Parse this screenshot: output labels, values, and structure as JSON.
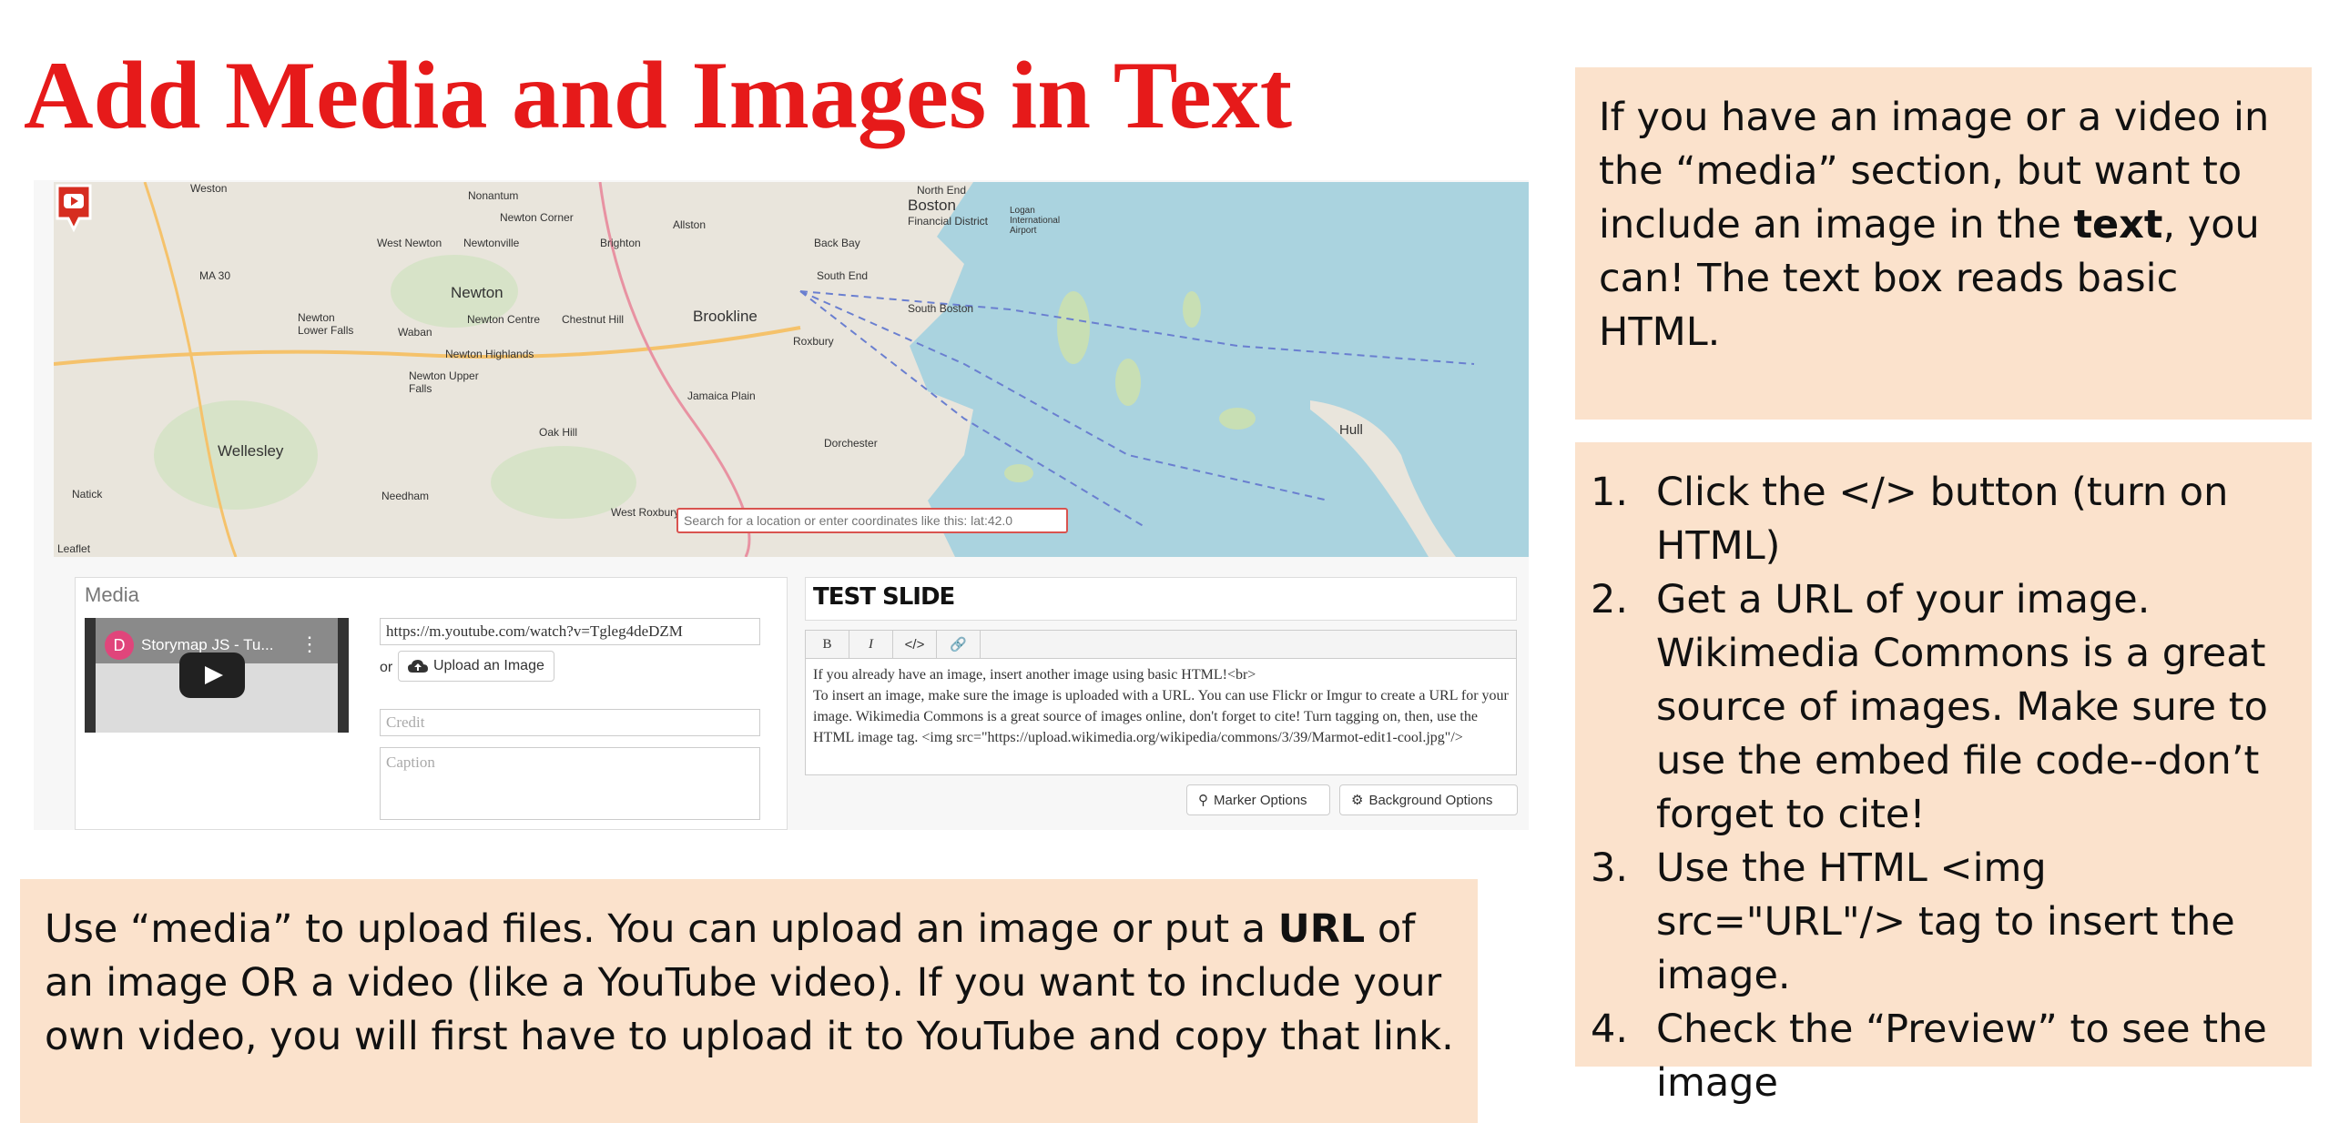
{
  "slide": {
    "title": "Add Media and Images in Text"
  },
  "callout_top": {
    "pre": "If you have an image or a video in the “media” section, but want to include an image in the ",
    "bold": "text",
    "post": ", you can! The text box reads basic HTML."
  },
  "callout_steps": [
    {
      "num": "1.",
      "text": "Click the </> button (turn on HTML)"
    },
    {
      "num": "2.",
      "text": "Get a URL of your image. Wikimedia Commons is a great source of images. Make sure to use the embed file code--don’t forget to cite!"
    },
    {
      "num": "3.",
      "text": "Use the HTML <img src=\"URL\"/> tag to insert the image."
    },
    {
      "num": "4.",
      "text": "Check the “Preview” to see the image"
    }
  ],
  "callout_bottom": {
    "pre": "Use “media” to upload files. You can upload an image or put a ",
    "bold": "URL",
    "post": " of an image OR a video (like a YouTube video). If you want to include your own video, you will first have to upload it to YouTube and copy that link."
  },
  "map": {
    "labels": [
      "Weston",
      "Nonantum",
      "Newton Corner",
      "Allston",
      "North End",
      "Boston",
      "Financial District",
      "Logan International Airport",
      "West Newton",
      "Newtonville",
      "Brighton",
      "Back Bay",
      "MA 30",
      "Newton",
      "South End",
      "Newton Lower Falls",
      "Waban",
      "Newton Centre",
      "Chestnut Hill",
      "Brookline",
      "South Boston",
      "Newton Highlands",
      "Roxbury",
      "Newton Upper Falls",
      "Jamaica Plain",
      "Oak Hill",
      "Hull",
      "Wellesley",
      "Dorchester",
      "Natick",
      "Needham",
      "West Roxbury"
    ],
    "search_placeholder": "Search for a location or enter coordinates like this: lat:42.0",
    "attribution": "Leaflet"
  },
  "media": {
    "label": "Media",
    "url_value": "https://m.youtube.com/watch?v=Tgleg4deDZM",
    "or_text": "or",
    "upload_label": "Upload an Image",
    "credit_placeholder": "Credit",
    "caption_placeholder": "Caption",
    "video": {
      "avatar_letter": "D",
      "title": "Storymap JS - Tu..."
    }
  },
  "text_panel": {
    "slide_title": "TEST SLIDE",
    "toolbar": {
      "bold": "B",
      "italic": "I",
      "html": "</>",
      "link": "🔗"
    },
    "body": "If you already have an image, insert another image using basic HTML!<br>\nTo insert an image, make sure the image is uploaded with a URL. You can use Flickr or Imgur to create a URL for your image. Wikimedia Commons is a great source of images online, don't forget to cite! Turn tagging on, then, use the HTML image tag. <img src=\"https://upload.wikimedia.org/wikipedia/commons/3/39/Marmot-edit1-cool.jpg\"/>",
    "marker_options": "Marker Options",
    "background_options": "Background Options"
  },
  "colors": {
    "title": "#e61a1a",
    "callout_bg": "#fbe2cc",
    "water": "#aad3df",
    "land": "#e9e5dc",
    "marker": "#d62d20"
  }
}
